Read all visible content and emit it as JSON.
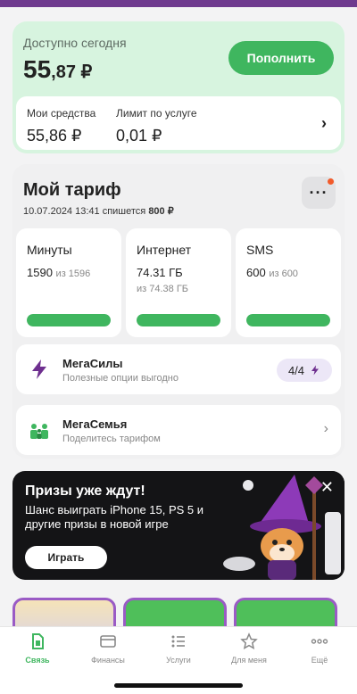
{
  "balance": {
    "label": "Доступно сегодня",
    "amount_main": "55",
    "amount_cents": ",87 ₽",
    "topup_label": "Пополнить",
    "my_funds_label": "Мои средства",
    "my_funds_value": "55,86 ₽",
    "limit_label": "Лимит по услуге",
    "limit_value": "0,01 ₽"
  },
  "tariff": {
    "title": "Мой тариф",
    "charge_text": "10.07.2024 13:41 спишется",
    "charge_amount": "800 ₽",
    "packs": [
      {
        "name": "Минуты",
        "value": "1590",
        "of": "из 1596",
        "extra": "",
        "progress": 0.996
      },
      {
        "name": "Интернет",
        "value": "74.31 ГБ",
        "of": "",
        "extra": "из 74.38 ГБ",
        "progress": 0.999
      },
      {
        "name": "SMS",
        "value": "600",
        "of": "из 600",
        "extra": "",
        "progress": 1.0
      }
    ],
    "megasily": {
      "title": "МегаСилы",
      "subtitle": "Полезные опции выгодно",
      "badge": "4/4"
    },
    "megasemya": {
      "title": "МегаСемья",
      "subtitle": "Поделитесь тарифом"
    }
  },
  "promo": {
    "title": "Призы уже ждут!",
    "text": "Шанс выиграть iPhone 15, PS 5 и другие призы в новой игре",
    "button": "Играть"
  },
  "nav": {
    "items": [
      {
        "label": "Связь",
        "icon": "sim-icon",
        "active": true
      },
      {
        "label": "Финансы",
        "icon": "card-icon",
        "active": false
      },
      {
        "label": "Услуги",
        "icon": "list-icon",
        "active": false
      },
      {
        "label": "Для меня",
        "icon": "star-icon",
        "active": false
      },
      {
        "label": "Ещё",
        "icon": "more-icon",
        "active": false
      }
    ]
  },
  "colors": {
    "accent": "#3fb65f",
    "purple": "#9a5bc5",
    "balance_bg": "#d7f4df"
  }
}
